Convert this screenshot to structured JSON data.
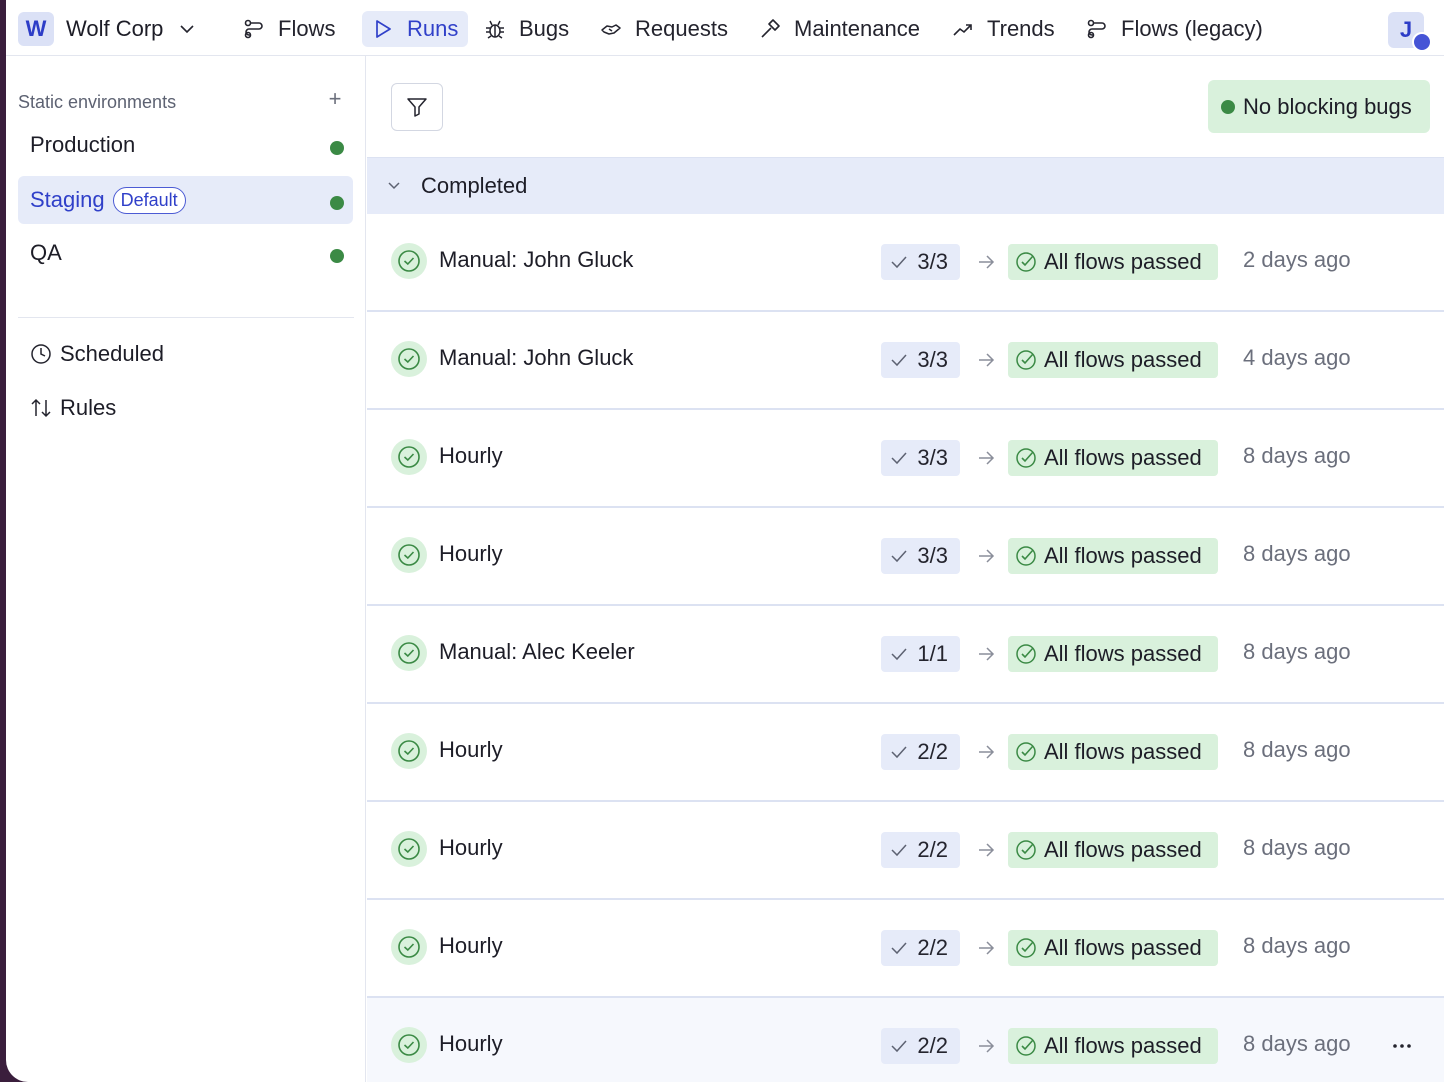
{
  "org": {
    "initial": "W",
    "name": "Wolf Corp"
  },
  "nav": [
    {
      "label": "Flows",
      "icon": "flows-icon"
    },
    {
      "label": "Runs",
      "icon": "play-icon",
      "active": true
    },
    {
      "label": "Bugs",
      "icon": "bug-icon"
    },
    {
      "label": "Requests",
      "icon": "handshake-icon"
    },
    {
      "label": "Maintenance",
      "icon": "hammer-icon"
    },
    {
      "label": "Trends",
      "icon": "trend-icon"
    },
    {
      "label": "Flows (legacy)",
      "icon": "flows-icon"
    }
  ],
  "user": {
    "initial": "J"
  },
  "sidebar": {
    "title": "Static environments",
    "add_label": "+",
    "environments": [
      {
        "name": "Production",
        "status_color": "#3b8a45"
      },
      {
        "name": "Staging",
        "badge": "Default",
        "active": true,
        "status_color": "#3b8a45"
      },
      {
        "name": "QA",
        "status_color": "#3b8a45"
      }
    ],
    "links": [
      {
        "label": "Scheduled",
        "icon": "clock-icon"
      },
      {
        "label": "Rules",
        "icon": "sort-arrows-icon"
      }
    ]
  },
  "toolbar": {
    "bugs_status": "No blocking bugs"
  },
  "group": {
    "label": "Completed"
  },
  "runs": [
    {
      "name": "Manual: John Gluck",
      "count": "3/3",
      "result": "All flows passed",
      "time": "2 days ago"
    },
    {
      "name": "Manual: John Gluck",
      "count": "3/3",
      "result": "All flows passed",
      "time": "4 days ago"
    },
    {
      "name": "Hourly",
      "count": "3/3",
      "result": "All flows passed",
      "time": "8 days ago"
    },
    {
      "name": "Hourly",
      "count": "3/3",
      "result": "All flows passed",
      "time": "8 days ago"
    },
    {
      "name": "Manual: Alec Keeler",
      "count": "1/1",
      "result": "All flows passed",
      "time": "8 days ago"
    },
    {
      "name": "Hourly",
      "count": "2/2",
      "result": "All flows passed",
      "time": "8 days ago"
    },
    {
      "name": "Hourly",
      "count": "2/2",
      "result": "All flows passed",
      "time": "8 days ago"
    },
    {
      "name": "Hourly",
      "count": "2/2",
      "result": "All flows passed",
      "time": "8 days ago"
    },
    {
      "name": "Hourly",
      "count": "2/2",
      "result": "All flows passed",
      "time": "8 days ago",
      "hovered": true
    }
  ],
  "colors": {
    "accent": "#3040c9",
    "success": "#3b8a45",
    "success_bg": "#d9f1dc",
    "active_bg": "#e6ebf9"
  }
}
